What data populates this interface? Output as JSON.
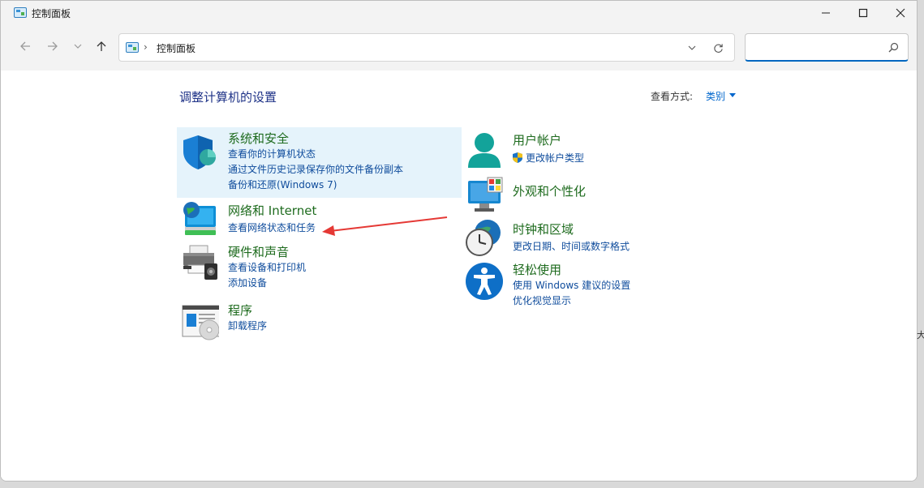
{
  "window": {
    "title": "控制面板",
    "minimize_icon": "minimize-icon",
    "maximize_icon": "maximize-icon",
    "close_icon": "close-icon"
  },
  "toolbar": {
    "breadcrumb": "控制面板",
    "search_placeholder": "",
    "search_value": ""
  },
  "main": {
    "heading": "调整计算机的设置",
    "view_by_label": "查看方式:",
    "view_by_value": "类别",
    "left_categories": [
      {
        "title": "系统和安全",
        "icon": "shield-icon",
        "links": [
          "查看你的计算机状态",
          "通过文件历史记录保存你的文件备份副本",
          "备份和还原(Windows 7)"
        ]
      },
      {
        "title": "网络和 Internet",
        "icon": "globe-monitor-icon",
        "links": [
          "查看网络状态和任务"
        ]
      },
      {
        "title": "硬件和声音",
        "icon": "printer-icon",
        "links": [
          "查看设备和打印机",
          "添加设备"
        ]
      },
      {
        "title": "程序",
        "icon": "program-disc-icon",
        "links": [
          "卸载程序"
        ]
      }
    ],
    "right_categories": [
      {
        "title": "用户帐户",
        "icon": "user-icon",
        "links": [
          "更改帐户类型"
        ]
      },
      {
        "title": "外观和个性化",
        "icon": "monitor-palette-icon",
        "links": []
      },
      {
        "title": "时钟和区域",
        "icon": "clock-globe-icon",
        "links": [
          "更改日期、时间或数字格式"
        ]
      },
      {
        "title": "轻松使用",
        "icon": "accessibility-icon",
        "links": [
          "使用 Windows 建议的设置",
          "优化视觉显示"
        ]
      }
    ]
  },
  "colors": {
    "category_title": "#1e6b1e",
    "link": "#0f4c9c",
    "heading": "#1e3287",
    "highlight": "#e5f3fb",
    "annotation_arrow": "#e53935"
  }
}
